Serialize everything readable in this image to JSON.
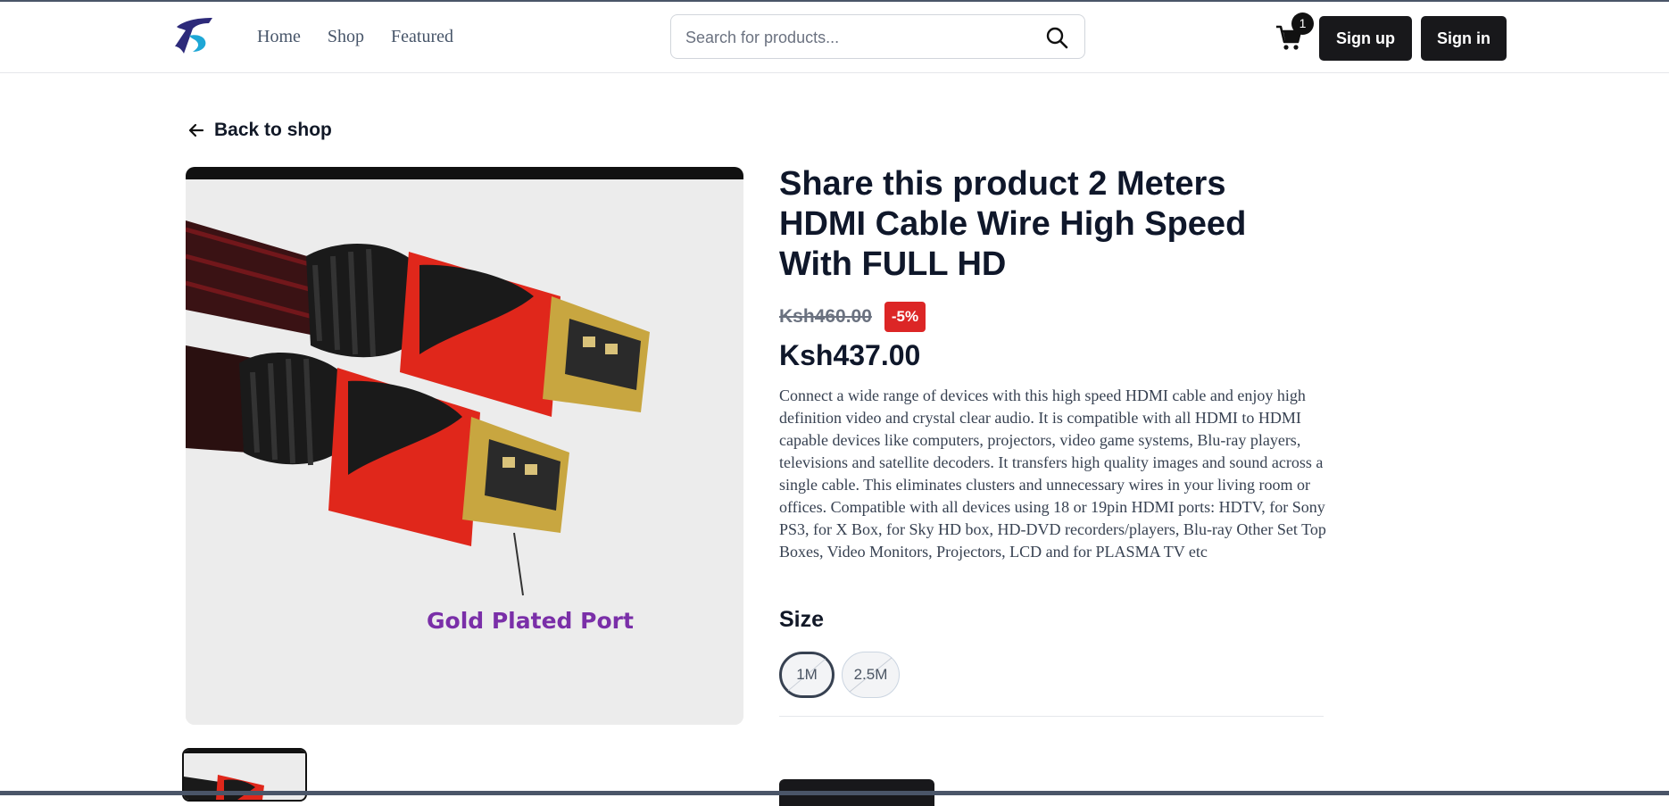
{
  "header": {
    "nav": [
      {
        "label": "Home"
      },
      {
        "label": "Shop"
      },
      {
        "label": "Featured"
      }
    ],
    "search": {
      "placeholder": "Search for products...",
      "value": ""
    },
    "cart": {
      "count": "1",
      "icon": "cart-icon"
    },
    "signup_label": "Sign up",
    "signin_label": "Sign in"
  },
  "main": {
    "back_label": "Back to shop",
    "product": {
      "title": "Share this product 2 Meters HDMI Cable Wire High Speed With FULL HD",
      "old_price": "Ksh460.00",
      "discount": "-5%",
      "price": "Ksh437.00",
      "description": "Connect a wide range of devices with this high speed HDMI cable and enjoy high definition video and crystal clear audio. It is compatible with all HDMI to HDMI capable devices like computers, projectors, video game systems, Blu-ray players, televisions and satellite decoders. It transfers high quality images and sound across a single cable. This eliminates clusters and unnecessary wires in your living room or offices. Compatible with all devices using 18 or 19pin HDMI ports: HDTV, for Sony PS3, for X Box, for Sky HD box, HD-DVD recorders/players, Blu-ray Other Set Top Boxes, Video Monitors, Projectors, LCD and for PLASMA TV etc",
      "image_caption": "Gold Plated Port",
      "size_label": "Size",
      "sizes": [
        {
          "label": "1M",
          "selected": true
        },
        {
          "label": "2.5M",
          "selected": false
        }
      ]
    }
  },
  "colors": {
    "brand_dark": "#18181b",
    "discount_red": "#dc2626",
    "cable_red": "#e0271b"
  }
}
